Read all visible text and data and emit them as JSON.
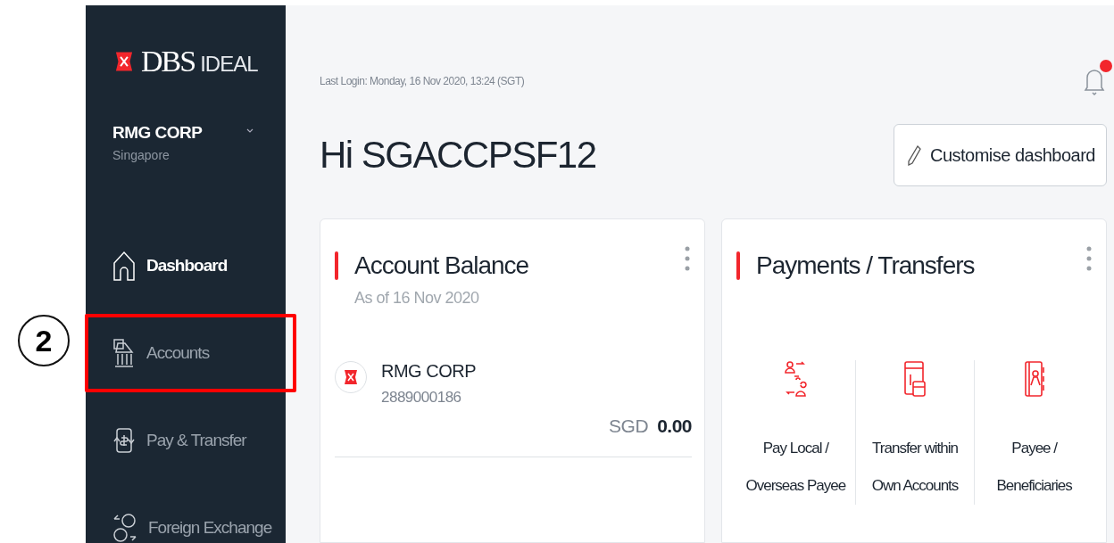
{
  "annotation": {
    "step": "2"
  },
  "sidebar": {
    "logo": {
      "brand": "DBS",
      "product": "IDEAL"
    },
    "company": {
      "name": "RMG CORP",
      "country": "Singapore"
    },
    "items": [
      {
        "label": "Dashboard",
        "kind": "home",
        "selected": true,
        "highlighted": false
      },
      {
        "label": "Accounts",
        "kind": "bank",
        "selected": false,
        "highlighted": true
      },
      {
        "label": "Pay & Transfer",
        "kind": "pay",
        "selected": false,
        "highlighted": false
      },
      {
        "label": "Foreign Exchange",
        "kind": "fx",
        "selected": false,
        "highlighted": false
      }
    ]
  },
  "header": {
    "last_login": "Last Login: Monday, 16 Nov 2020, 13:24 (SGT)",
    "notification": true
  },
  "greeting": "Hi SGACCPSF12",
  "customise_button": "Customise dashboard",
  "account_card": {
    "title": "Account Balance",
    "as_of": "As of 16 Nov 2020",
    "account": {
      "name": "RMG CORP",
      "number": "2889000186",
      "currency": "SGD",
      "amount": "0.00"
    }
  },
  "payments_card": {
    "title": "Payments / Transfers",
    "actions": [
      {
        "kind": "people",
        "label": "Pay Local / Overseas Payee"
      },
      {
        "kind": "wallet",
        "label": "Transfer within Own Accounts"
      },
      {
        "kind": "book",
        "label": "Payee / Beneficiaries"
      }
    ]
  }
}
